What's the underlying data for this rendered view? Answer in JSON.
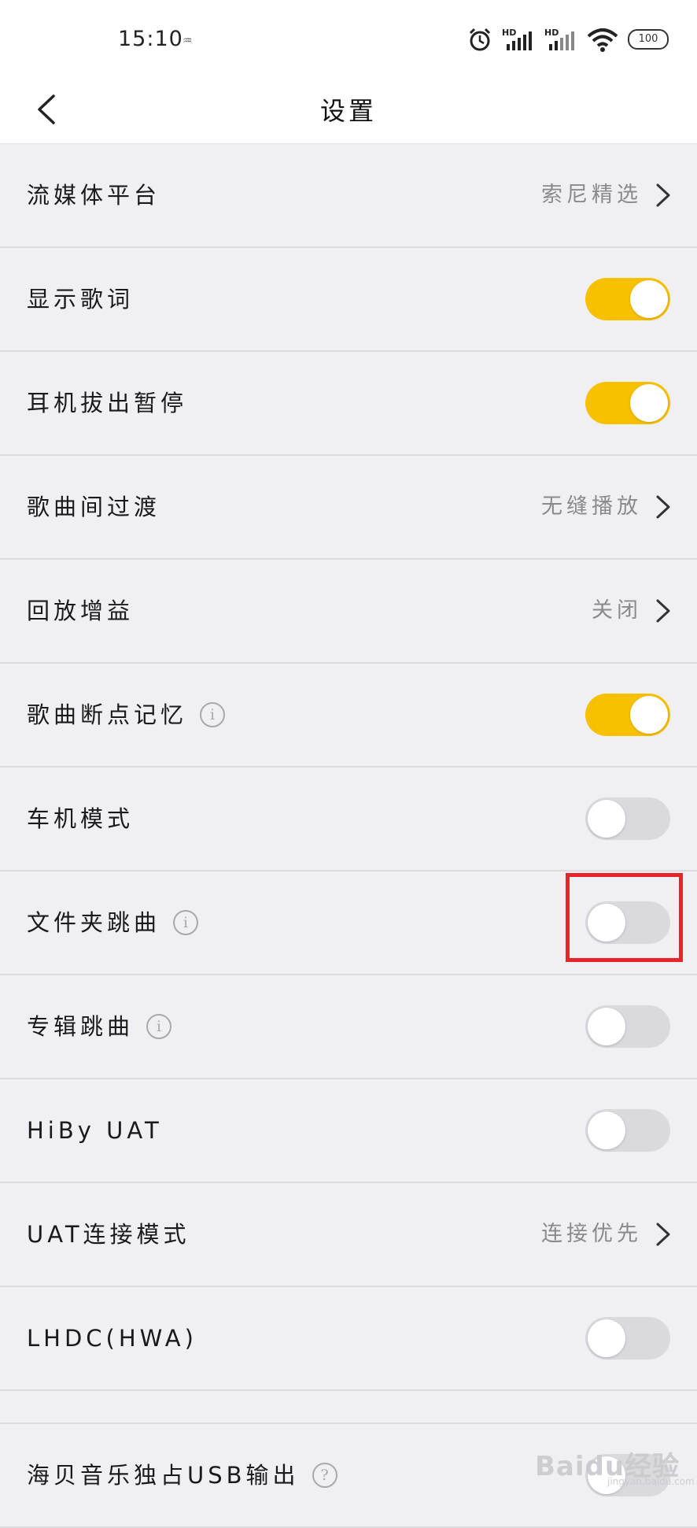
{
  "status_bar": {
    "time": "15:10",
    "battery": "100",
    "signal_labels": [
      "HD",
      "HD"
    ]
  },
  "header": {
    "title": "设置"
  },
  "settings": [
    {
      "label": "流媒体平台",
      "type": "nav",
      "value": "索尼精选"
    },
    {
      "label": "显示歌词",
      "type": "toggle",
      "on": true
    },
    {
      "label": "耳机拔出暂停",
      "type": "toggle",
      "on": true
    },
    {
      "label": "歌曲间过渡",
      "type": "nav",
      "value": "无缝播放"
    },
    {
      "label": "回放增益",
      "type": "nav",
      "value": "关闭"
    },
    {
      "label": "歌曲断点记忆",
      "type": "toggle",
      "on": true,
      "info": true
    },
    {
      "label": "车机模式",
      "type": "toggle",
      "on": false
    },
    {
      "label": "文件夹跳曲",
      "type": "toggle",
      "on": false,
      "info": true,
      "highlighted": true
    },
    {
      "label": "专辑跳曲",
      "type": "toggle",
      "on": false,
      "info": true
    },
    {
      "label": "HiBy UAT",
      "type": "toggle",
      "on": false
    },
    {
      "label": "UAT连接模式",
      "type": "nav",
      "value": "连接优先"
    },
    {
      "label": "LHDC(HWA)",
      "type": "toggle",
      "on": false
    },
    {
      "label": "海贝音乐独占USB输出",
      "type": "toggle",
      "on": false,
      "help": true
    }
  ],
  "colors": {
    "toggle_on": "#f8c100",
    "toggle_off": "#dadade",
    "highlight_box": "#e8232a",
    "background": "#f0f0f4"
  },
  "watermark": {
    "text": "Baidu经验",
    "sub": "jingyan.baidu.com"
  }
}
